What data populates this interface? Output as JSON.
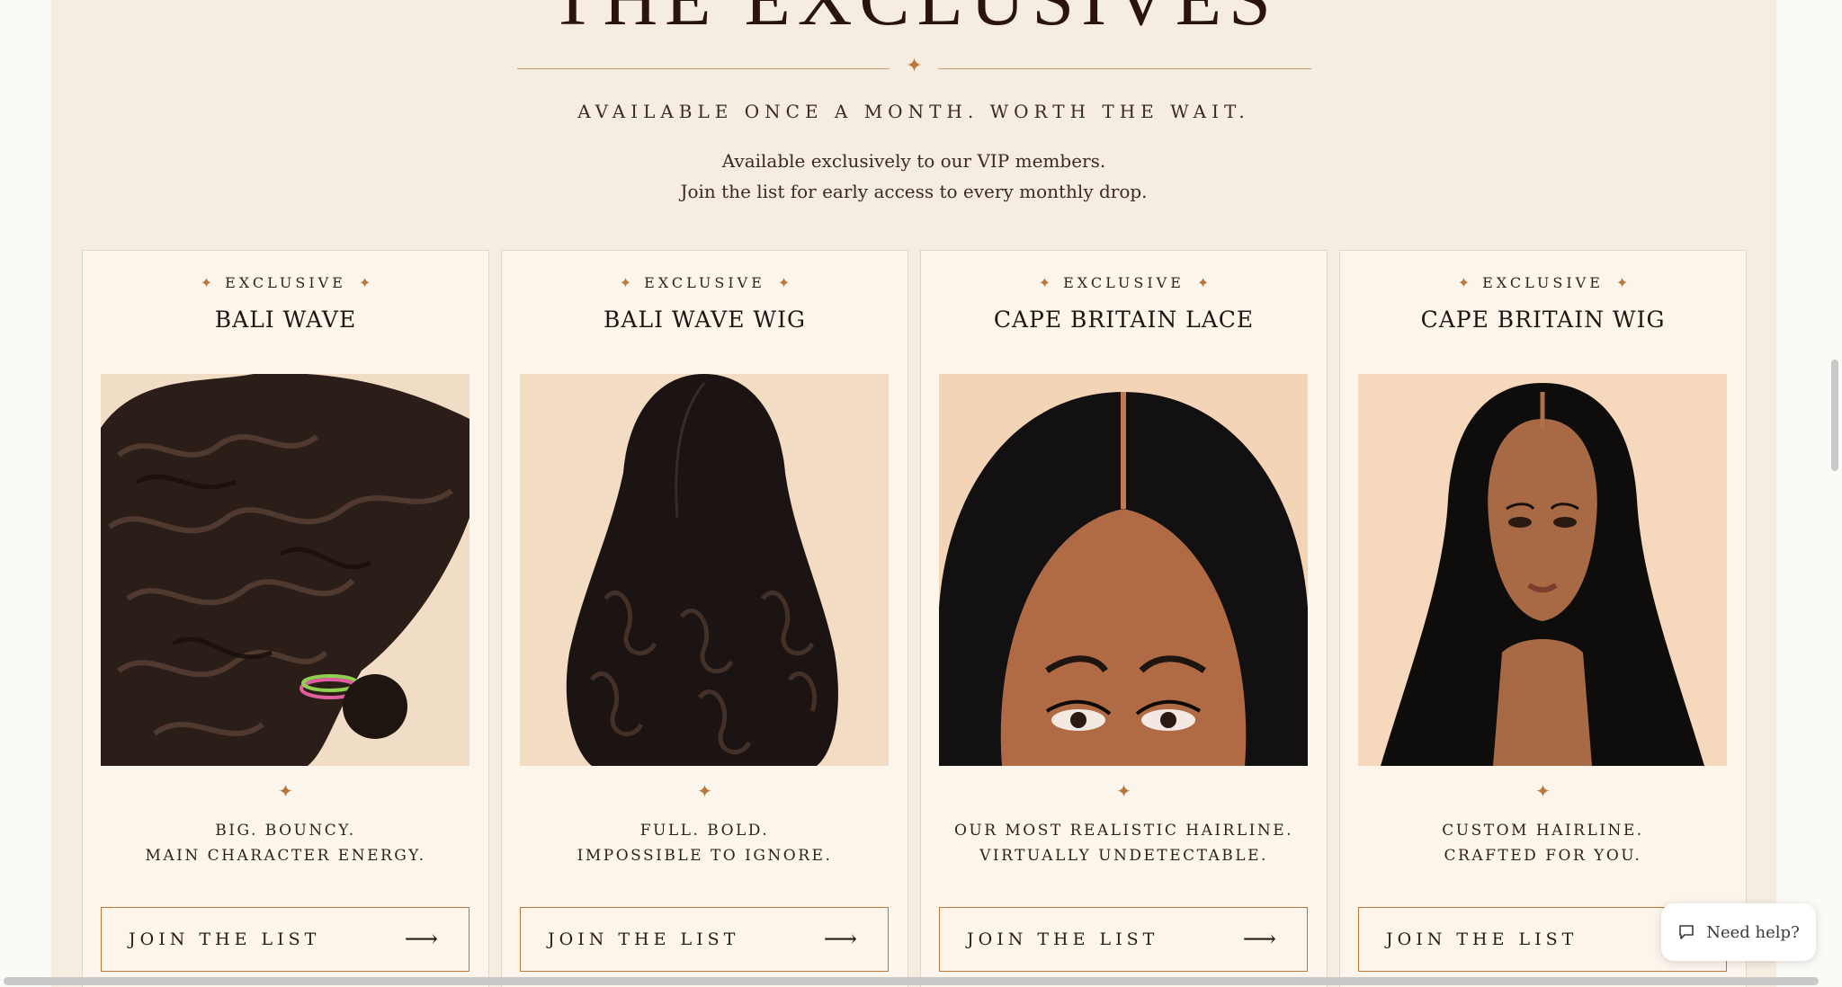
{
  "section": {
    "title": "THE EXCLUSIVES",
    "tagline": "AVAILABLE ONCE A MONTH. WORTH THE WAIT.",
    "description_line1": "Available exclusively to our VIP members.",
    "description_line2": "Join the list for early access to every monthly drop.",
    "divider_icon": "star-icon"
  },
  "products": [
    {
      "badge": "EXCLUSIVE",
      "name": "BALI WAVE",
      "image": "bali-wave-bundle-photo",
      "blurb_line1": "BIG. BOUNCY.",
      "blurb_line2": "MAIN CHARACTER ENERGY.",
      "cta": "JOIN THE LIST"
    },
    {
      "badge": "EXCLUSIVE",
      "name": "BALI WAVE WIG",
      "image": "bali-wave-wig-back-photo",
      "blurb_line1": "FULL. BOLD.",
      "blurb_line2": "IMPOSSIBLE TO IGNORE.",
      "cta": "JOIN THE LIST"
    },
    {
      "badge": "EXCLUSIVE",
      "name": "CAPE BRITAIN LACE",
      "image": "cape-britain-lace-hairline-photo",
      "blurb_line1": "OUR MOST REALISTIC HAIRLINE.",
      "blurb_line2": "VIRTUALLY UNDETECTABLE.",
      "cta": "JOIN THE LIST"
    },
    {
      "badge": "EXCLUSIVE",
      "name": "CAPE BRITAIN WIG",
      "image": "cape-britain-wig-model-photo",
      "blurb_line1": "CUSTOM HAIRLINE.",
      "blurb_line2": "CRAFTED FOR YOU.",
      "cta": "JOIN THE LIST"
    }
  ],
  "help_widget": {
    "label": "Need help?",
    "icon": "chat-bubble-icon"
  },
  "colors": {
    "page_bg": "#fcfaf7",
    "panel_bg": "#f5ece2",
    "card_bg": "#fcf5ec",
    "accent": "#b9773a",
    "text": "#2b1a12"
  }
}
